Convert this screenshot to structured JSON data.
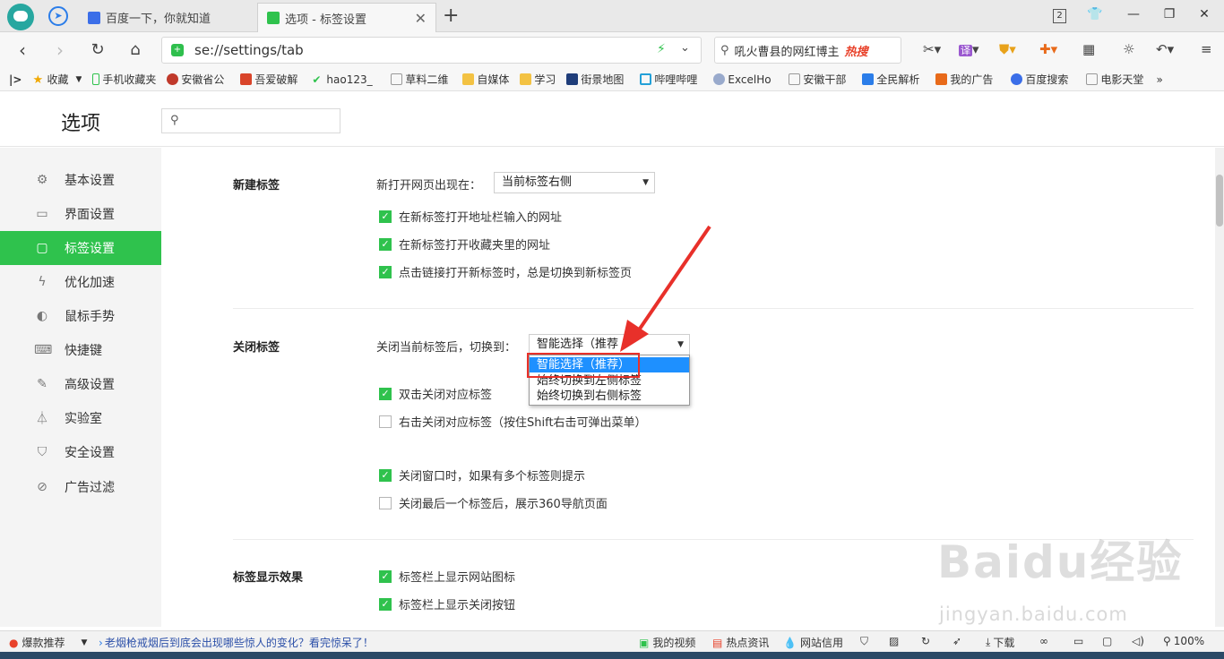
{
  "browser": {
    "tabs": [
      {
        "label": "百度一下，你就知道"
      },
      {
        "label": "选项 - 标签设置"
      }
    ],
    "tab_counter": "2",
    "address": "se://settings/tab",
    "search_text": "吼火曹县的网红博主",
    "hot_label": "热搜",
    "translate_label": "译"
  },
  "bookmarks": [
    "收藏",
    "手机收藏夹",
    "安徽省公",
    "吾爱破解",
    "hao123_",
    "草料二维",
    "自媒体",
    "学习",
    "街景地图",
    "哔哩哔哩",
    "ExcelHo",
    "安徽干部",
    "全民解析",
    "我的广告",
    "百度搜索",
    "电影天堂"
  ],
  "bookmarks_more": "»",
  "page": {
    "title": "选项",
    "search_placeholder": ""
  },
  "sidebar": {
    "items": [
      {
        "label": "基本设置",
        "icon": "gear-icon"
      },
      {
        "label": "界面设置",
        "icon": "window-icon"
      },
      {
        "label": "标签设置",
        "icon": "tab-icon"
      },
      {
        "label": "优化加速",
        "icon": "lightning-icon"
      },
      {
        "label": "鼠标手势",
        "icon": "mouse-icon"
      },
      {
        "label": "快捷键",
        "icon": "keyboard-icon"
      },
      {
        "label": "高级设置",
        "icon": "wrench-icon"
      },
      {
        "label": "实验室",
        "icon": "flask-icon"
      },
      {
        "label": "安全设置",
        "icon": "shield-icon"
      },
      {
        "label": "广告过滤",
        "icon": "block-icon"
      }
    ],
    "active_index": 2
  },
  "sections": {
    "new_tab": {
      "title": "新建标签",
      "open_label": "新打开网页出现在：",
      "open_value": "当前标签右侧",
      "options": [
        {
          "label": "在新标签打开地址栏输入的网址",
          "checked": true
        },
        {
          "label": "在新标签打开收藏夹里的网址",
          "checked": true
        },
        {
          "label": "点击链接打开新标签时，总是切换到新标签页",
          "checked": true
        }
      ]
    },
    "close_tab": {
      "title": "关闭标签",
      "switch_label": "关闭当前标签后，切换到：",
      "switch_value": "智能选择（推荐",
      "dropdown_options": [
        "智能选择（推荐）",
        "始终切换到左侧标签",
        "始终切换到右侧标签"
      ],
      "options": [
        {
          "label": "双击关闭对应标签",
          "checked": true
        },
        {
          "label": "右击关闭对应标签（按住Shift右击可弹出菜单）",
          "checked": false
        },
        {
          "label": "关闭窗口时，如果有多个标签则提示",
          "checked": true
        },
        {
          "label": "关闭最后一个标签后，展示360导航页面",
          "checked": false
        }
      ]
    },
    "display": {
      "title": "标签显示效果",
      "options": [
        {
          "label": "标签栏上显示网站图标",
          "checked": true
        },
        {
          "label": "标签栏上显示关闭按钮",
          "checked": true
        }
      ]
    }
  },
  "statusbar": {
    "left_label": "爆款推荐",
    "news": "老烟枪戒烟后到底会出现哪些惊人的变化？看完惊呆了！",
    "video": "我的视频",
    "hot_news": "热点资讯",
    "credit": "网站信用",
    "download": "下载",
    "zoom": "100%"
  },
  "watermark": {
    "logo": "Baidu经验",
    "url": "jingyan.baidu.com"
  },
  "colors": {
    "accent": "#2fc24d",
    "highlight": "#1e90ff",
    "annotation": "#e8302a"
  }
}
